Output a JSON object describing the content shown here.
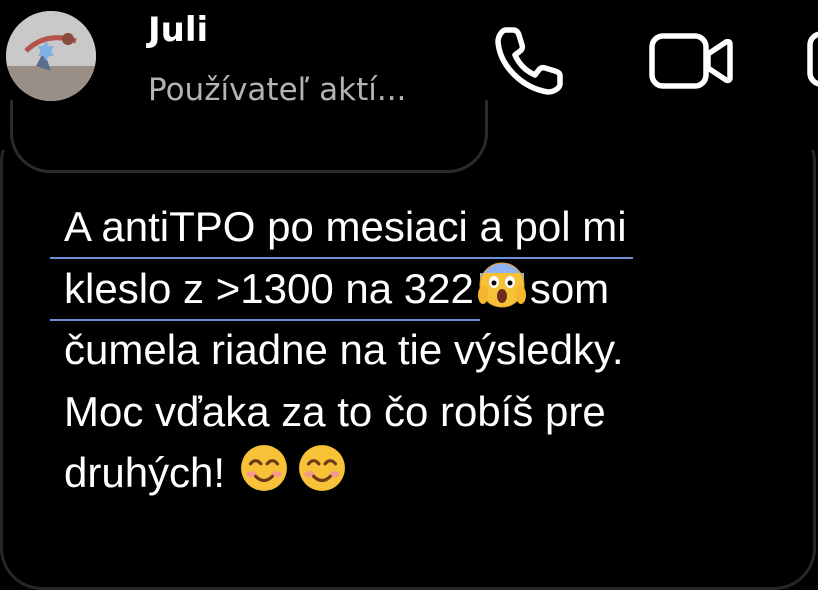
{
  "header": {
    "contact_name": "Juli",
    "contact_status": "Používateľ aktí..."
  },
  "icons": {
    "call": "phone-icon",
    "video": "video-camera-icon",
    "info": "info-icon"
  },
  "message": {
    "lines": [
      "A antiTPO po mesiaci a pol mi",
      "kleslo z >1300 na 322",
      "som",
      "čumela riadne na tie výsledky.",
      "Moc vďaka za to čo robíš pre",
      "druhých!"
    ],
    "emojis": [
      "screaming-face-emoji",
      "smiling-face-emoji",
      "smiling-face-emoji"
    ]
  },
  "colors": {
    "background": "#000000",
    "underline": "#6b8ed6",
    "status_text": "#b3b3b3",
    "bubble_border": "#262626"
  }
}
